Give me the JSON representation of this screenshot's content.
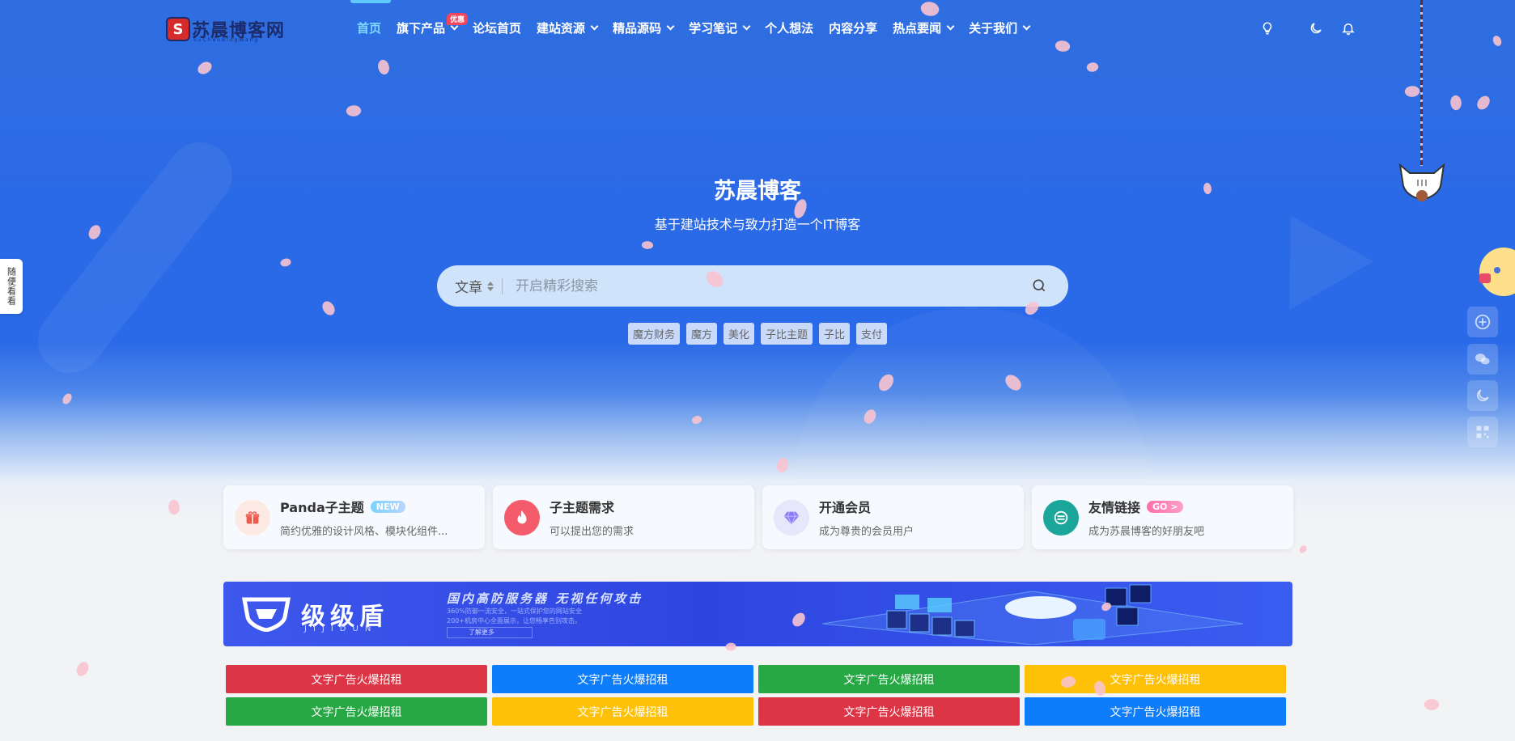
{
  "header": {
    "logo": {
      "mark": "S",
      "text": "苏晨博客网",
      "sub": "SuChenBlogWang"
    },
    "nav": [
      {
        "label": "首页",
        "active": true,
        "dropdown": false
      },
      {
        "label": "旗下产品",
        "active": false,
        "dropdown": true,
        "badge": "优惠"
      },
      {
        "label": "论坛首页",
        "active": false,
        "dropdown": false
      },
      {
        "label": "建站资源",
        "active": false,
        "dropdown": true
      },
      {
        "label": "精品源码",
        "active": false,
        "dropdown": true
      },
      {
        "label": "学习笔记",
        "active": false,
        "dropdown": true
      },
      {
        "label": "个人想法",
        "active": false,
        "dropdown": false
      },
      {
        "label": "内容分享",
        "active": false,
        "dropdown": false
      },
      {
        "label": "热点要闻",
        "active": false,
        "dropdown": true
      },
      {
        "label": "关于我们",
        "active": false,
        "dropdown": true
      }
    ],
    "icons": [
      "lightbulb-icon",
      "moon-icon",
      "bell-icon"
    ]
  },
  "hero": {
    "title": "苏晨博客",
    "subtitle": "基于建站技术与致力打造一个IT博客",
    "search": {
      "type": "文章",
      "placeholder": "开启精彩搜索"
    },
    "tags": [
      "魔方财务",
      "魔方",
      "美化",
      "子比主题",
      "子比",
      "支付"
    ]
  },
  "cards": [
    {
      "title": "Panda子主题",
      "badge": "NEW",
      "desc": "简约优雅的设计风格、模块化组件...",
      "icon": "gift-icon",
      "color": "#f0584a",
      "bg": "#fde9e3"
    },
    {
      "title": "子主题需求",
      "badge": "",
      "desc": "可以提出您的需求",
      "icon": "fire-icon",
      "color": "#ffffff",
      "bg": "#f45b6b"
    },
    {
      "title": "开通会员",
      "badge": "",
      "desc": "成为尊贵的会员用户",
      "icon": "diamond-icon",
      "color": "#8b7cf6",
      "bg": "#e7e6fb"
    },
    {
      "title": "友情链接",
      "badge": "GO >",
      "desc": "成为苏晨博客的好朋友吧",
      "icon": "link-icon",
      "color": "#ffffff",
      "bg": "#1aa79a"
    }
  ],
  "banner": {
    "name": "级级盾",
    "name_en": "JIJIDUN",
    "headline": "国内高防服务器 无视任何攻击",
    "line1": "360%防御一流安全，一站式保护您的网站安全",
    "line2": "200+机房中心全面展示，让您畅享告别攻击。",
    "button": "了解更多"
  },
  "text_ads": [
    {
      "label": "文字广告火爆招租",
      "color": "#dc3545"
    },
    {
      "label": "文字广告火爆招租",
      "color": "#0d7dfb"
    },
    {
      "label": "文字广告火爆招租",
      "color": "#28a745"
    },
    {
      "label": "文字广告火爆招租",
      "color": "#ffc107"
    },
    {
      "label": "文字广告火爆招租",
      "color": "#28a745"
    },
    {
      "label": "文字广告火爆招租",
      "color": "#ffc107"
    },
    {
      "label": "文字广告火爆招租",
      "color": "#dc3545"
    },
    {
      "label": "文字广告火爆招租",
      "color": "#0d7dfb"
    }
  ],
  "side_tab": {
    "label": "随便看看"
  },
  "right_tools": [
    "plus-circle-icon",
    "wechat-icon",
    "moon-icon",
    "qrcode-icon"
  ]
}
